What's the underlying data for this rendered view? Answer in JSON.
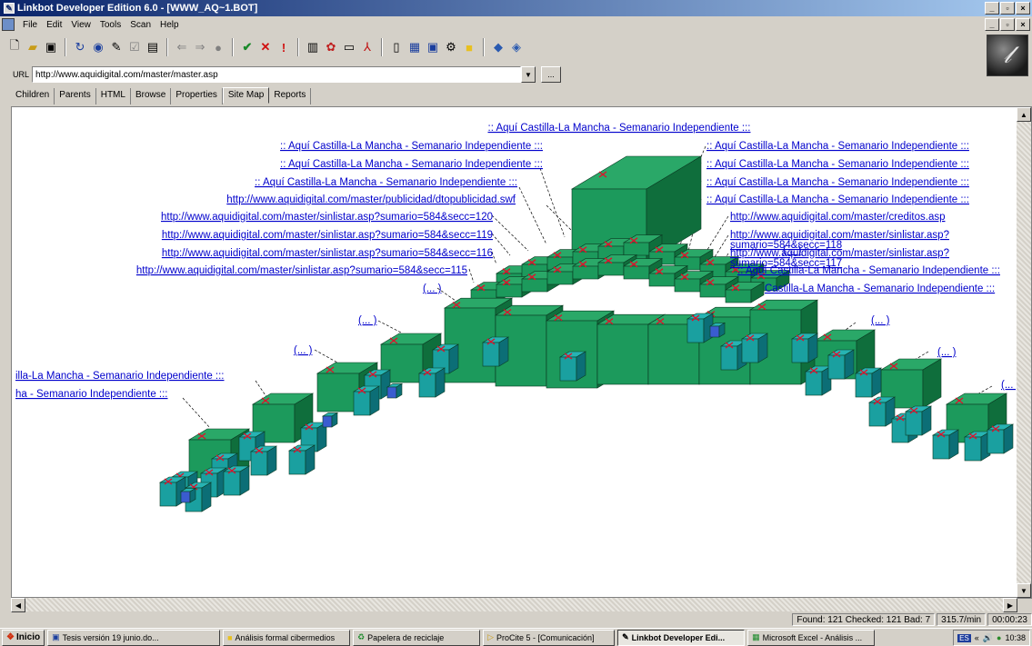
{
  "window": {
    "title": "Linkbot Developer Edition 6.0  - [WWW_AQ~1.BOT]",
    "minimize_glyph": "_",
    "restore_glyph": "▫",
    "close_glyph": "×"
  },
  "menu": [
    "File",
    "Edit",
    "View",
    "Tools",
    "Scan",
    "Help"
  ],
  "toolbar": {
    "icons": [
      "new-doc-icon",
      "open-folder-icon",
      "save-icon",
      "refresh-icon",
      "spider-icon",
      "pencil-icon",
      "check-box-icon",
      "properties-icon",
      "back-arrow-icon",
      "forward-arrow-icon",
      "stop-dot-icon",
      "check-icon",
      "cross-icon",
      "exclamation-icon",
      "report-icon",
      "color-icon",
      "window-icon",
      "pdf-icon",
      "page-icon",
      "site-icon",
      "screen-icon",
      "gear-icon",
      "folder-icon",
      "globe-icon",
      "globe-back-icon"
    ]
  },
  "address": {
    "label": "URL",
    "value": "http://www.aquidigital.com/master/master.asp",
    "more_label": "..."
  },
  "tabs": [
    "Children",
    "Parents",
    "HTML",
    "Browse",
    "Properties",
    "Site Map",
    "Reports"
  ],
  "active_tab": "Site Map",
  "sitemap": {
    "root_label": ":: Aquí Castilla-La Mancha - Semanario Independiente :::",
    "labels_left": [
      ":: Aquí Castilla-La Mancha - Semanario Independiente :::",
      ":: Aquí Castilla-La Mancha - Semanario Independiente :::",
      ":: Aquí Castilla-La Mancha - Semanario Independiente :::",
      "http://www.aquidigital.com/master/publicidad/dtopublicidad.swf",
      "http://www.aquidigital.com/master/sinlistar.asp?sumario=584&secc=120",
      "http://www.aquidigital.com/master/sinlistar.asp?sumario=584&secc=119",
      "http://www.aquidigital.com/master/sinlistar.asp?sumario=584&secc=116",
      "http://www.aquidigital.com/master/sinlistar.asp?sumario=584&secc=115"
    ],
    "labels_right": [
      ":: Aquí Castilla-La Mancha - Semanario Independiente :::",
      ":: Aquí Castilla-La Mancha - Semanario Independiente :::",
      ":: Aquí Castilla-La Mancha - Semanario Independiente :::",
      ":: Aquí Castilla-La Mancha - Semanario Independiente :::",
      "http://www.aquidigital.com/master/creditos.asp",
      "http://www.aquidigital.com/master/sinlistar.asp?",
      "sumario=584&secc=118",
      "http://www.aquidigital.com/master/sinlistar.asp?",
      "sumario=584&secc=117",
      ":: Aquí Castilla-La Mancha - Semanario Independiente :::",
      "Castilla-La Mancha - Semanario Independiente :::"
    ],
    "labels_lower_left": [
      "illa-La Mancha - Semanario Independiente :::",
      "ha - Semanario Independiente :::"
    ],
    "ellipsis": "(... )",
    "colors": {
      "link": "#0000cc",
      "cube_top": "#2aa868",
      "cube_front": "#1c9a5c",
      "cube_side": "#0f6e3c",
      "teal_top": "#27b3b3",
      "teal_front": "#1aa0a0",
      "teal_side": "#0c6e76",
      "blue_front": "#3a5cd0",
      "x_mark": "#e0102a"
    }
  },
  "status": {
    "counts": "Found: 121 Checked: 121 Bad: 7",
    "rate": "315.7/min",
    "elapsed": "00:00:23"
  },
  "taskbar": {
    "start": "Inicio",
    "tasks": [
      "Tesis versión 19 junio.do...",
      "Análisis formal cibermedios",
      "Papelera de reciclaje",
      "ProCite 5 - [Comunicación]",
      "Linkbot Developer Edi...",
      "Microsoft Excel - Análisis ..."
    ],
    "active_task": 4,
    "lang": "ES",
    "tray_icons": "«",
    "clock": "10:38"
  }
}
